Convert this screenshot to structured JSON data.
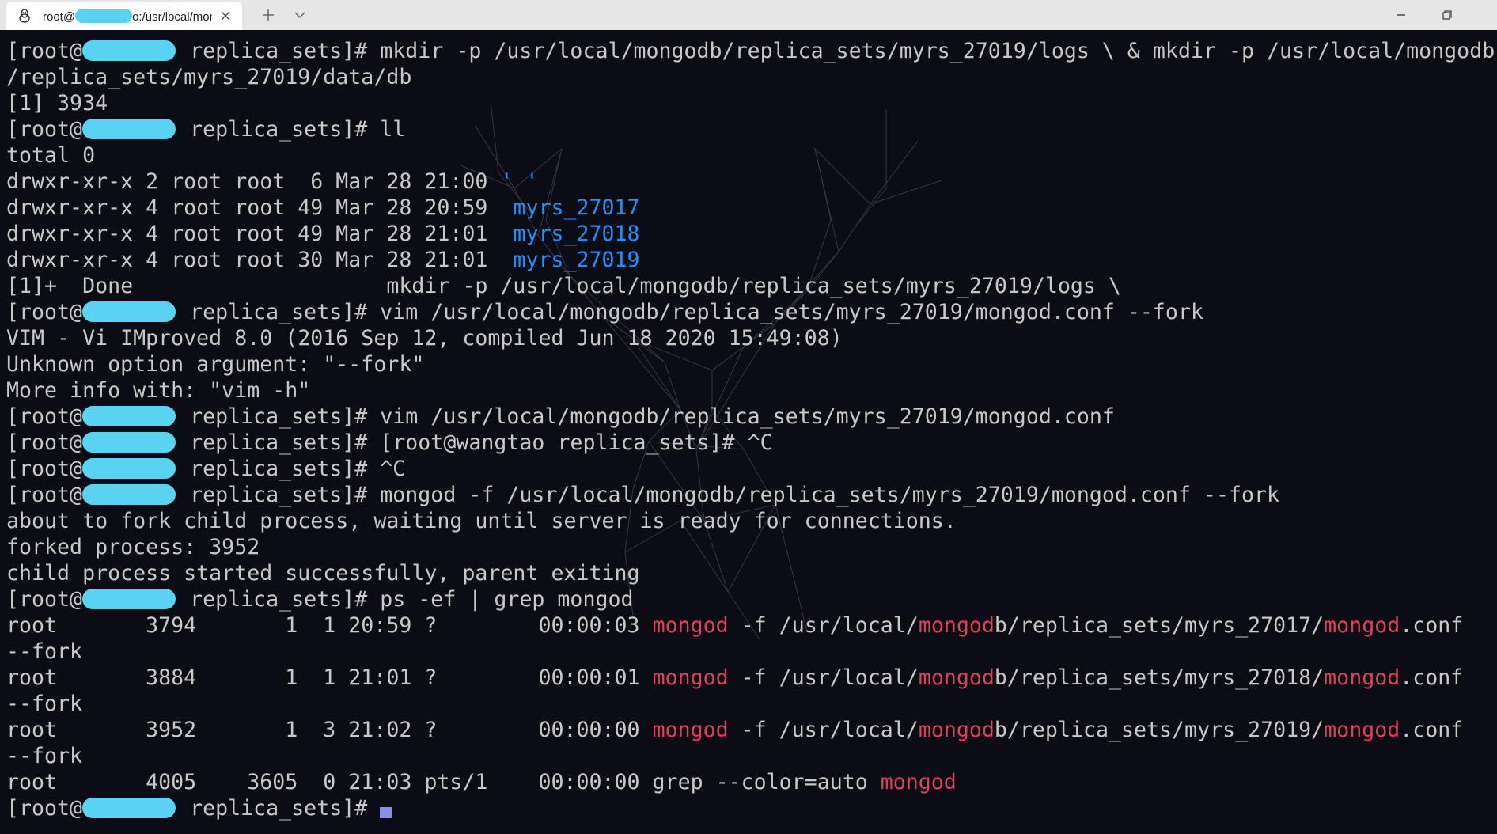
{
  "window": {
    "tab_title_prefix": "root@",
    "tab_title_suffix": "o:/usr/local/mong",
    "tab_icon": "linux-tux-icon",
    "close_icon": "close-icon",
    "new_tab_icon": "plus-icon",
    "dropdown_icon": "chevron-down-icon",
    "minimize_icon": "minimize-icon",
    "restore_icon": "restore-icon"
  },
  "colors": {
    "background": "#0c0c14",
    "text": "#c8c8c8",
    "directory": "#1e90ff",
    "match": "#e0405a",
    "redaction": "#5ad2f2",
    "cursor": "#8a8cf0"
  },
  "terminal": {
    "prompt_prefix": "[root@",
    "prompt_suffix": " replica_sets]# ",
    "lines": [
      {
        "type": "prompt",
        "cmd": "mkdir -p /usr/local/mongodb/replica_sets/myrs_27019/logs \\ & mkdir -p /usr/local/mongodb"
      },
      {
        "type": "text",
        "text": "/replica_sets/myrs_27019/data/db"
      },
      {
        "type": "text",
        "text": "[1] 3934"
      },
      {
        "type": "prompt",
        "cmd": "ll"
      },
      {
        "type": "text",
        "text": "total 0"
      },
      {
        "type": "ls",
        "text": "drwxr-xr-x 2 root root  6 Mar 28 21:00 ",
        "name": "' '"
      },
      {
        "type": "ls",
        "text": "drwxr-xr-x 4 root root 49 Mar 28 20:59  ",
        "name": "myrs_27017"
      },
      {
        "type": "ls",
        "text": "drwxr-xr-x 4 root root 49 Mar 28 21:01  ",
        "name": "myrs_27018"
      },
      {
        "type": "ls",
        "text": "drwxr-xr-x 4 root root 30 Mar 28 21:01  ",
        "name": "myrs_27019"
      },
      {
        "type": "text",
        "text": "[1]+  Done                    mkdir -p /usr/local/mongodb/replica_sets/myrs_27019/logs \\"
      },
      {
        "type": "prompt",
        "cmd": "vim /usr/local/mongodb/replica_sets/myrs_27019/mongod.conf --fork"
      },
      {
        "type": "text",
        "text": "VIM - Vi IMproved 8.0 (2016 Sep 12, compiled Jun 18 2020 15:49:08)"
      },
      {
        "type": "text",
        "text": "Unknown option argument: \"--fork\""
      },
      {
        "type": "text",
        "text": "More info with: \"vim -h\""
      },
      {
        "type": "prompt",
        "cmd": "vim /usr/local/mongodb/replica_sets/myrs_27019/mongod.conf"
      },
      {
        "type": "prompt",
        "cmd": "[root@wangtao replica_sets]# ^C"
      },
      {
        "type": "prompt",
        "cmd": "^C"
      },
      {
        "type": "prompt",
        "cmd": "mongod -f /usr/local/mongodb/replica_sets/myrs_27019/mongod.conf --fork"
      },
      {
        "type": "text",
        "text": "about to fork child process, waiting until server is ready for connections."
      },
      {
        "type": "text",
        "text": "forked process: 3952"
      },
      {
        "type": "text",
        "text": "child process started successfully, parent exiting"
      },
      {
        "type": "prompt",
        "cmd": "ps -ef | grep mongod"
      },
      {
        "type": "ps",
        "pre": "root       3794       1  1 20:59 ?        00:00:03 ",
        "m1": "mongod",
        "mid1": " -f /usr/local/",
        "m2": "mongod",
        "mid2": "b/replica_sets/myrs_27017/",
        "m3": "mongod",
        "post": ".conf"
      },
      {
        "type": "text",
        "text": "--fork"
      },
      {
        "type": "ps",
        "pre": "root       3884       1  1 21:01 ?        00:00:01 ",
        "m1": "mongod",
        "mid1": " -f /usr/local/",
        "m2": "mongod",
        "mid2": "b/replica_sets/myrs_27018/",
        "m3": "mongod",
        "post": ".conf"
      },
      {
        "type": "text",
        "text": "--fork"
      },
      {
        "type": "ps",
        "pre": "root       3952       1  3 21:02 ?        00:00:00 ",
        "m1": "mongod",
        "mid1": " -f /usr/local/",
        "m2": "mongod",
        "mid2": "b/replica_sets/myrs_27019/",
        "m3": "mongod",
        "post": ".conf"
      },
      {
        "type": "text",
        "text": "--fork"
      },
      {
        "type": "grep",
        "pre": "root       4005    3605  0 21:03 pts/1    00:00:00 grep --color=auto ",
        "m1": "mongod"
      },
      {
        "type": "prompt",
        "cmd": "",
        "cursor": true
      }
    ]
  }
}
